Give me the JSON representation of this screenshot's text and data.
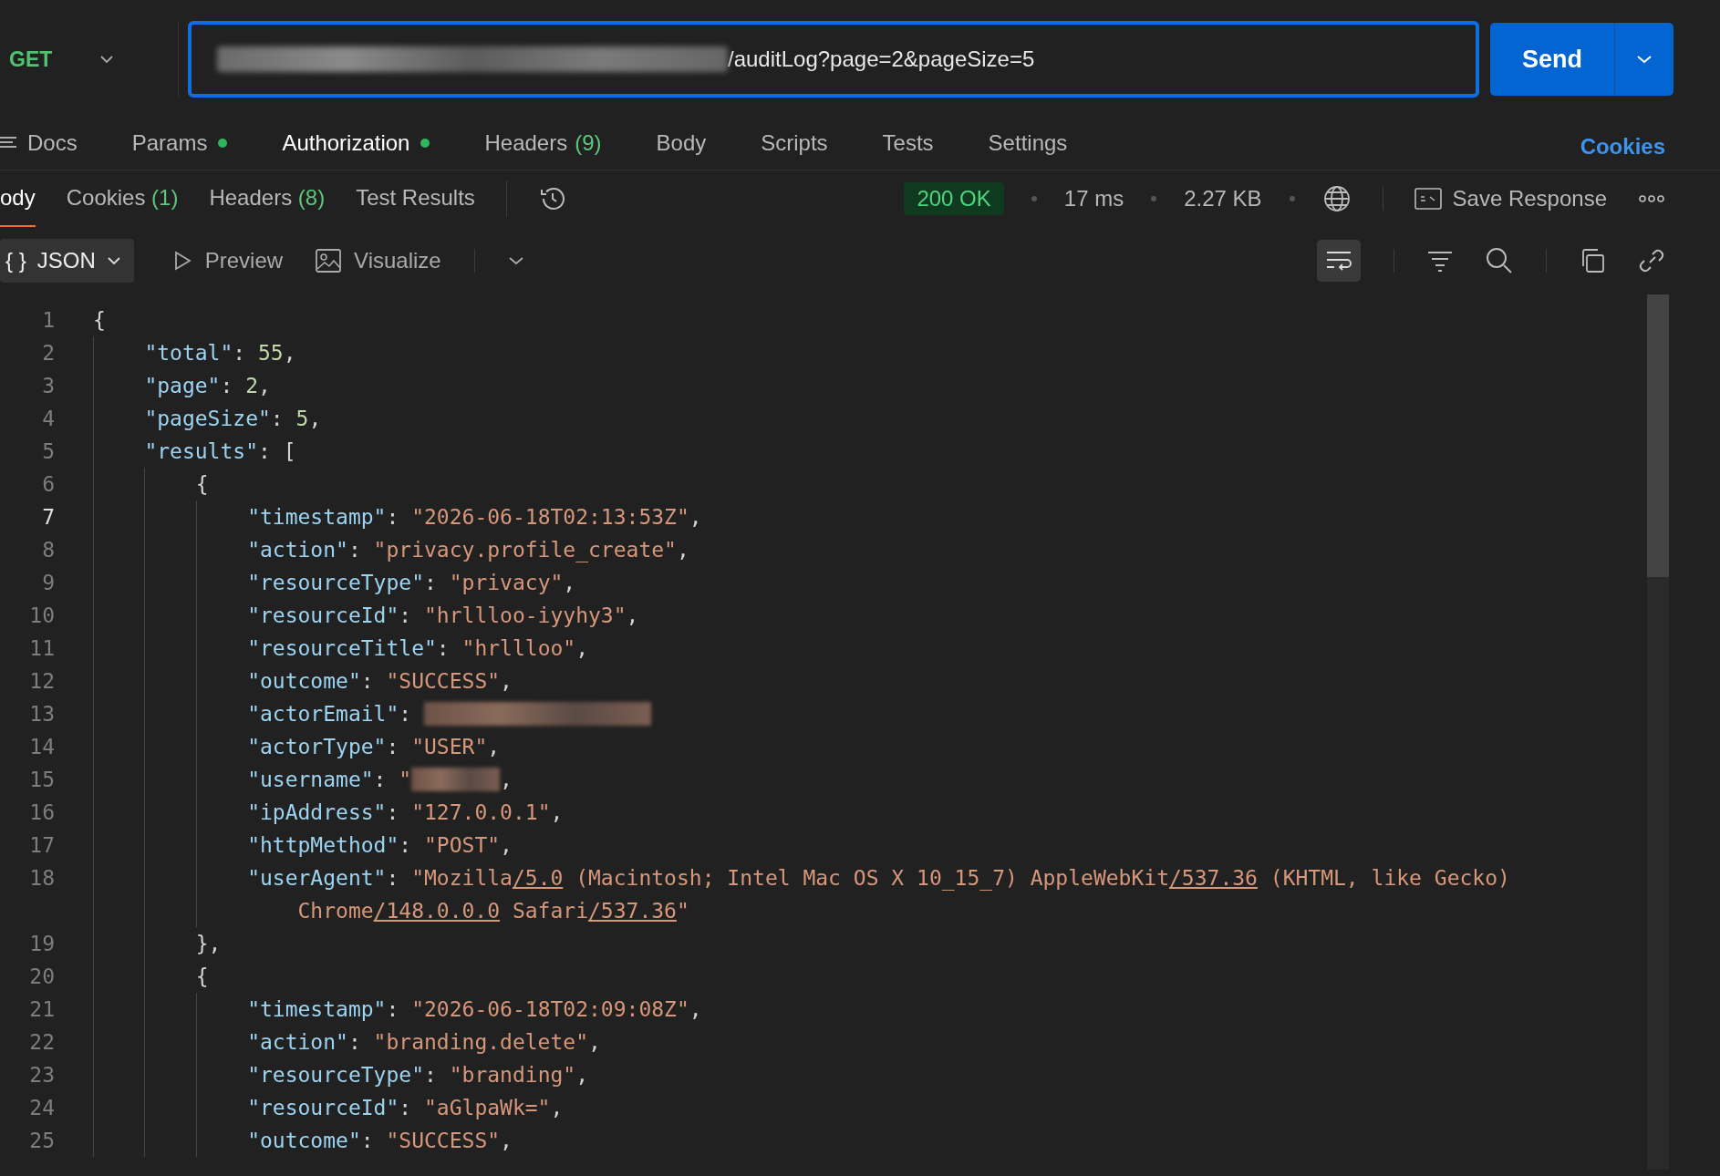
{
  "request": {
    "method": "GET",
    "url": "/auditLog?page=2&pageSize=5",
    "url_redacted": true,
    "send_label": "Send"
  },
  "request_tabs": [
    {
      "label": "Docs",
      "kind": "docs",
      "dot": false,
      "selected": false
    },
    {
      "label": "Params",
      "kind": "plain",
      "dot": true,
      "selected": false
    },
    {
      "label": "Authorization",
      "kind": "plain",
      "dot": true,
      "selected": true
    },
    {
      "label": "Headers",
      "kind": "plain",
      "count": "(9)",
      "dot": false,
      "selected": false
    },
    {
      "label": "Body",
      "kind": "plain",
      "dot": false,
      "selected": false
    },
    {
      "label": "Scripts",
      "kind": "plain",
      "dot": false,
      "selected": false
    },
    {
      "label": "Tests",
      "kind": "plain",
      "dot": false,
      "selected": false
    },
    {
      "label": "Settings",
      "kind": "plain",
      "dot": false,
      "selected": false
    }
  ],
  "cookies_link": "Cookies",
  "response_tabs": [
    {
      "label": "ody",
      "selected": true
    },
    {
      "label": "Cookies",
      "count": "(1)",
      "selected": false
    },
    {
      "label": "Headers",
      "count": "(8)",
      "selected": false
    },
    {
      "label": "Test Results",
      "selected": false
    }
  ],
  "status": {
    "code": "200 OK",
    "time": "17 ms",
    "size": "2.27 KB",
    "save_label": "Save Response"
  },
  "format": {
    "glyph": "{ }",
    "label": "JSON",
    "preview": "Preview",
    "visualize": "Visualize",
    "wrap_on": true
  },
  "lines": [
    {
      "num": "1",
      "active": false,
      "tokens": [
        {
          "kind": "punct",
          "text": "{"
        }
      ]
    },
    {
      "num": "2",
      "active": false,
      "tokens": [
        {
          "kind": "key",
          "text": "\"total\""
        },
        {
          "kind": "punct",
          "text": ": "
        },
        {
          "kind": "number",
          "text": "55"
        },
        {
          "kind": "punct",
          "text": ","
        }
      ]
    },
    {
      "num": "3",
      "active": false,
      "tokens": [
        {
          "kind": "key",
          "text": "\"page\""
        },
        {
          "kind": "punct",
          "text": ": "
        },
        {
          "kind": "number",
          "text": "2"
        },
        {
          "kind": "punct",
          "text": ","
        }
      ]
    },
    {
      "num": "4",
      "active": false,
      "tokens": [
        {
          "kind": "key",
          "text": "\"pageSize\""
        },
        {
          "kind": "punct",
          "text": ": "
        },
        {
          "kind": "number",
          "text": "5"
        },
        {
          "kind": "punct",
          "text": ","
        }
      ]
    },
    {
      "num": "5",
      "active": false,
      "tokens": [
        {
          "kind": "key",
          "text": "\"results\""
        },
        {
          "kind": "punct",
          "text": ": ["
        }
      ]
    },
    {
      "num": "6",
      "active": false,
      "tokens": [
        {
          "kind": "punct",
          "text": "{"
        }
      ]
    },
    {
      "num": "7",
      "active": true,
      "tokens": [
        {
          "kind": "key",
          "text": "\"timestamp\""
        },
        {
          "kind": "punct",
          "text": ": "
        },
        {
          "kind": "string",
          "text": "\"2026-06-18T02:13:53Z\""
        },
        {
          "kind": "punct",
          "text": ","
        }
      ]
    },
    {
      "num": "8",
      "active": false,
      "tokens": [
        {
          "kind": "key",
          "text": "\"action\""
        },
        {
          "kind": "punct",
          "text": ": "
        },
        {
          "kind": "string",
          "text": "\"privacy.profile_create\""
        },
        {
          "kind": "punct",
          "text": ","
        }
      ]
    },
    {
      "num": "9",
      "active": false,
      "tokens": [
        {
          "kind": "key",
          "text": "\"resourceType\""
        },
        {
          "kind": "punct",
          "text": ": "
        },
        {
          "kind": "string",
          "text": "\"privacy\""
        },
        {
          "kind": "punct",
          "text": ","
        }
      ]
    },
    {
      "num": "10",
      "active": false,
      "tokens": [
        {
          "kind": "key",
          "text": "\"resourceId\""
        },
        {
          "kind": "punct",
          "text": ": "
        },
        {
          "kind": "string",
          "text": "\"hrllloo-iyyhy3\""
        },
        {
          "kind": "punct",
          "text": ","
        }
      ]
    },
    {
      "num": "11",
      "active": false,
      "tokens": [
        {
          "kind": "key",
          "text": "\"resourceTitle\""
        },
        {
          "kind": "punct",
          "text": ": "
        },
        {
          "kind": "string",
          "text": "\"hrllloo\""
        },
        {
          "kind": "punct",
          "text": ","
        }
      ]
    },
    {
      "num": "12",
      "active": false,
      "tokens": [
        {
          "kind": "key",
          "text": "\"outcome\""
        },
        {
          "kind": "punct",
          "text": ": "
        },
        {
          "kind": "string",
          "text": "\"SUCCESS\""
        },
        {
          "kind": "punct",
          "text": ","
        }
      ]
    },
    {
      "num": "13",
      "active": false,
      "tokens": [
        {
          "kind": "key",
          "text": "\"actorEmail\""
        },
        {
          "kind": "punct",
          "text": ": "
        },
        {
          "kind": "redacted"
        }
      ]
    },
    {
      "num": "14",
      "active": false,
      "tokens": [
        {
          "kind": "key",
          "text": "\"actorType\""
        },
        {
          "kind": "punct",
          "text": ": "
        },
        {
          "kind": "string",
          "text": "\"USER\""
        },
        {
          "kind": "punct",
          "text": ","
        }
      ]
    },
    {
      "num": "15",
      "active": false,
      "tokens": [
        {
          "kind": "key",
          "text": "\"username\""
        },
        {
          "kind": "punct",
          "text": ": "
        },
        {
          "kind": "string",
          "text": "\""
        },
        {
          "kind": "redacted"
        },
        {
          "kind": "punct",
          "text": ","
        }
      ]
    },
    {
      "num": "16",
      "active": false,
      "tokens": [
        {
          "kind": "key",
          "text": "\"ipAddress\""
        },
        {
          "kind": "punct",
          "text": ": "
        },
        {
          "kind": "string",
          "text": "\"127.0.0.1\""
        },
        {
          "kind": "punct",
          "text": ","
        }
      ]
    },
    {
      "num": "17",
      "active": false,
      "tokens": [
        {
          "kind": "key",
          "text": "\"httpMethod\""
        },
        {
          "kind": "punct",
          "text": ": "
        },
        {
          "kind": "string",
          "text": "\"POST\""
        },
        {
          "kind": "punct",
          "text": ","
        }
      ]
    },
    {
      "num": "18",
      "active": false,
      "tokens": [
        {
          "kind": "key",
          "text": "\"userAgent\""
        },
        {
          "kind": "punct",
          "text": ": "
        },
        {
          "kind": "string",
          "text": "\"Mozilla"
        },
        {
          "kind": "link",
          "text": "/5.0"
        },
        {
          "kind": "string",
          "text": " (Macintosh; Intel Mac OS X 10_15_7) AppleWebKit"
        },
        {
          "kind": "link",
          "text": "/537.36"
        },
        {
          "kind": "string",
          "text": " (KHTML, like Gecko)"
        }
      ],
      "continuation": [
        {
          "kind": "string",
          "text": "Chrome"
        },
        {
          "kind": "link",
          "text": "/148.0.0.0"
        },
        {
          "kind": "string",
          "text": " Safari"
        },
        {
          "kind": "link",
          "text": "/537.36"
        },
        {
          "kind": "string",
          "text": "\""
        }
      ]
    },
    {
      "num": "19",
      "active": false,
      "tokens": [
        {
          "kind": "punct",
          "text": "},"
        }
      ]
    },
    {
      "num": "20",
      "active": false,
      "tokens": [
        {
          "kind": "punct",
          "text": "{"
        }
      ]
    },
    {
      "num": "21",
      "active": false,
      "tokens": [
        {
          "kind": "key",
          "text": "\"timestamp\""
        },
        {
          "kind": "punct",
          "text": ": "
        },
        {
          "kind": "string",
          "text": "\"2026-06-18T02:09:08Z\""
        },
        {
          "kind": "punct",
          "text": ","
        }
      ]
    },
    {
      "num": "22",
      "active": false,
      "tokens": [
        {
          "kind": "key",
          "text": "\"action\""
        },
        {
          "kind": "punct",
          "text": ": "
        },
        {
          "kind": "string",
          "text": "\"branding.delete\""
        },
        {
          "kind": "punct",
          "text": ","
        }
      ]
    },
    {
      "num": "23",
      "active": false,
      "tokens": [
        {
          "kind": "key",
          "text": "\"resourceType\""
        },
        {
          "kind": "punct",
          "text": ": "
        },
        {
          "kind": "string",
          "text": "\"branding\""
        },
        {
          "kind": "punct",
          "text": ","
        }
      ]
    },
    {
      "num": "24",
      "active": false,
      "tokens": [
        {
          "kind": "key",
          "text": "\"resourceId\""
        },
        {
          "kind": "punct",
          "text": ": "
        },
        {
          "kind": "string",
          "text": "\"aGlpaWk=\""
        },
        {
          "kind": "punct",
          "text": ","
        }
      ]
    },
    {
      "num": "25",
      "active": false,
      "tokens": [
        {
          "kind": "key",
          "text": "\"outcome\""
        },
        {
          "kind": "punct",
          "text": ": "
        },
        {
          "kind": "string",
          "text": "\"SUCCESS\""
        },
        {
          "kind": "punct",
          "text": ","
        }
      ]
    }
  ]
}
